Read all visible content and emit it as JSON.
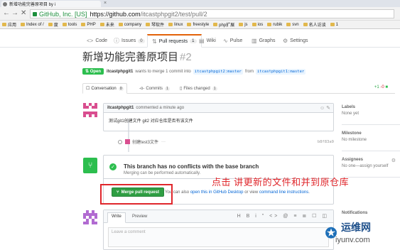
{
  "browser": {
    "tab_title": "新增功能完善原项目 by i",
    "url_ev": "GitHub, Inc. [US]",
    "url_host": "https://github.com",
    "url_path": "/itcastphpgit2/test/pull/2",
    "bookmarks": [
      "应用",
      "Index of /",
      "度",
      "tools",
      "PHP",
      "未来",
      "company",
      "琴软件",
      "linux",
      "freestyle",
      "php扩展",
      "js",
      "ios",
      "rubik",
      "svn",
      "名人访谈",
      "1"
    ]
  },
  "repo_nav": {
    "code": "Code",
    "issues": "Issues",
    "issues_count": "0",
    "pulls": "Pull requests",
    "pulls_count": "1",
    "wiki": "Wiki",
    "pulse": "Pulse",
    "graphs": "Graphs",
    "settings": "Settings"
  },
  "pr": {
    "title": "新增功能完善原项目",
    "number": "#2",
    "status": "Open",
    "author": "itcastphpgit1",
    "merge_text": "wants to merge 1 commit into",
    "base_branch": "itcastphpgit2:master",
    "from_text": "from",
    "head_branch": "itcastphpgit1:master"
  },
  "pr_tabs": {
    "conversation": "Conversation",
    "conversation_count": "0",
    "commits": "Commits",
    "commits_count": "1",
    "files": "Files changed",
    "files_count": "1",
    "additions": "+1",
    "deletions": "-0"
  },
  "comment": {
    "author": "itcastphpgit1",
    "time": "commented a minute ago",
    "body": "测试git1创建文件 git2 对应仓库是否有该文件"
  },
  "commit": {
    "message": "创建test3文件",
    "dots": "···",
    "sha": "b8f83a9"
  },
  "merge": {
    "title": "This branch has no conflicts with the base branch",
    "subtitle": "Merging can be performed automatically.",
    "button": "Merge pull request",
    "note_prefix": "You can also",
    "note_link1": "open this in GitHub Desktop",
    "note_mid": "or view",
    "note_link2": "command line instructions",
    "note_suffix": "."
  },
  "annotation": "点击   讲更新的文件和并到原仓库",
  "new_comment": {
    "write": "Write",
    "preview": "Preview",
    "toolbar": "H B i \" <> @ ≡ ≣ ☐ ◫",
    "placeholder": "Leave a comment"
  },
  "sidebar": {
    "labels_h": "Labels",
    "labels_v": "None yet",
    "milestone_h": "Milestone",
    "milestone_v": "No milestone",
    "assignees_h": "Assignees",
    "assignees_v": "No one—assign yourself",
    "notifications_h": "Notifications"
  },
  "watermark": {
    "cn": "运维网",
    "en": "iyunv.com"
  }
}
